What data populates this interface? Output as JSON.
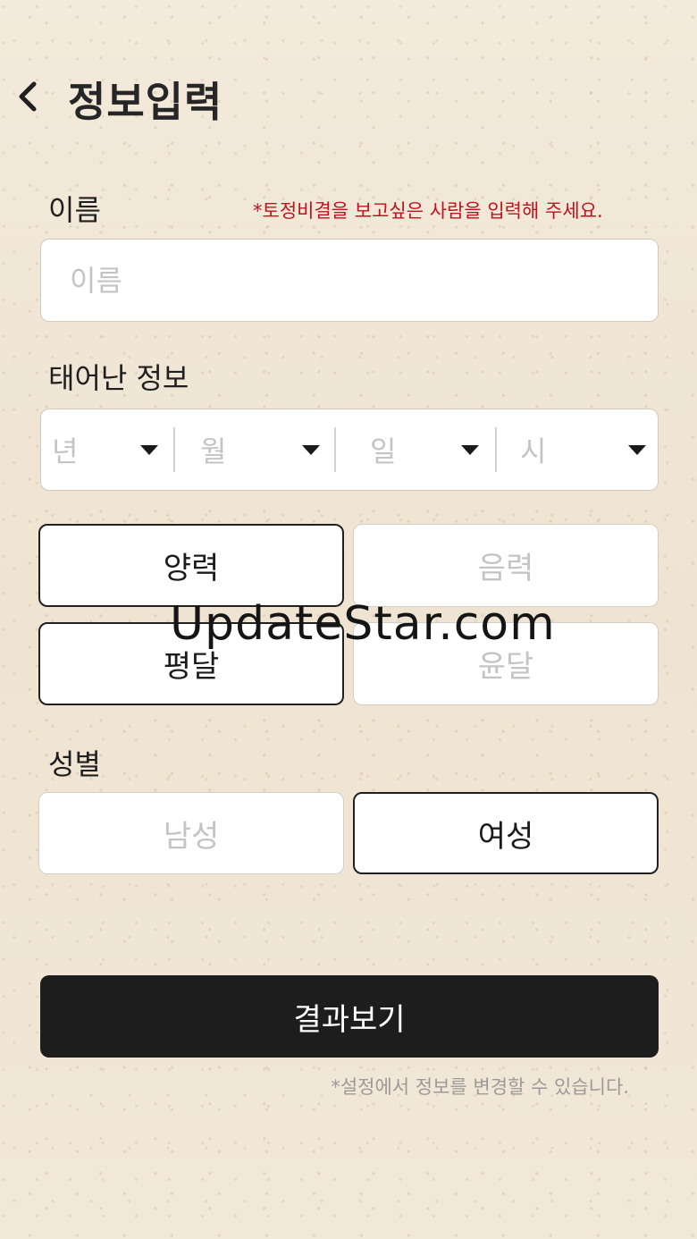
{
  "header": {
    "title": "정보입력"
  },
  "name_section": {
    "label": "이름",
    "note": "*토정비결을 보고싶은 사람을 입력해 주세요.",
    "placeholder": "이름"
  },
  "birth_section": {
    "label": "태어난 정보",
    "selects": [
      {
        "key": "year",
        "placeholder": "년"
      },
      {
        "key": "month",
        "placeholder": "월"
      },
      {
        "key": "day",
        "placeholder": "일"
      },
      {
        "key": "hour",
        "placeholder": "시"
      }
    ],
    "calendar_options": [
      {
        "label": "양력",
        "selected": true
      },
      {
        "label": "음력",
        "selected": false
      }
    ],
    "month_options": [
      {
        "label": "평달",
        "selected": true
      },
      {
        "label": "윤달",
        "selected": false
      }
    ]
  },
  "gender_section": {
    "label": "성별",
    "options": [
      {
        "label": "남성",
        "selected": false
      },
      {
        "label": "여성",
        "selected": true
      }
    ]
  },
  "submit": {
    "label": "결과보기"
  },
  "footer_note": "*설정에서 정보를 변경할 수 있습니다.",
  "watermark": "UpdateStar.com",
  "colors": {
    "accent_dark": "#1e1d1d",
    "note_red": "#c1121f",
    "paper": "#f1e6d6"
  },
  "icons": {
    "back": "chevron-left-icon",
    "dropdown": "caret-down-icon"
  }
}
